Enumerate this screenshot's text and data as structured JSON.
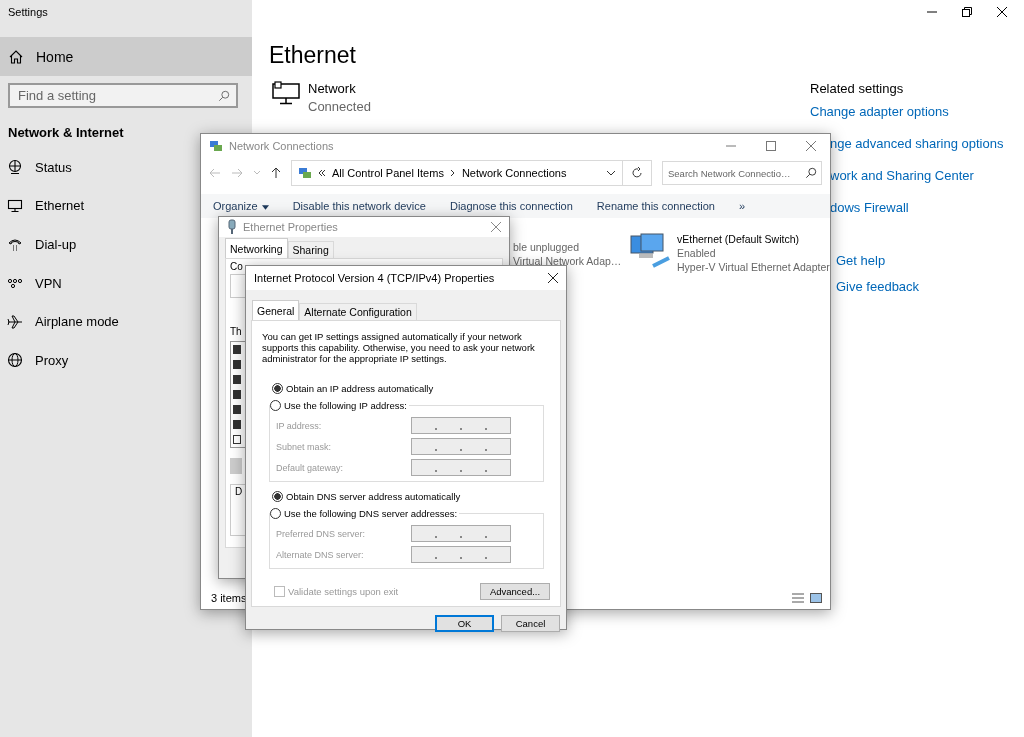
{
  "settings": {
    "title": "Settings",
    "home": "Home",
    "search_placeholder": "Find a setting",
    "section": "Network & Internet",
    "nav": [
      {
        "label": "Status"
      },
      {
        "label": "Ethernet"
      },
      {
        "label": "Dial-up"
      },
      {
        "label": "VPN"
      },
      {
        "label": "Airplane mode"
      },
      {
        "label": "Proxy"
      }
    ]
  },
  "page": {
    "heading": "Ethernet",
    "network_name": "Network",
    "network_status": "Connected"
  },
  "related": {
    "title": "Related settings",
    "links": [
      {
        "label": "Change adapter options",
        "cut": false
      },
      {
        "label": "nge advanced sharing options",
        "cut": true
      },
      {
        "label": "work and Sharing Center",
        "cut": true
      },
      {
        "label": "dows Firewall",
        "cut": true
      }
    ]
  },
  "help_links": [
    {
      "label": "Get help"
    },
    {
      "label": "Give feedback"
    }
  ],
  "network_connections": {
    "title": "Network Connections",
    "breadcrumb": [
      "All Control Panel Items",
      "Network Connections"
    ],
    "search_placeholder": "Search Network Connectio…",
    "toolbar": [
      {
        "label": "Organize",
        "dropdown": true
      },
      {
        "label": "Disable this network device",
        "dropdown": false
      },
      {
        "label": "Diagnose this connection",
        "dropdown": false
      },
      {
        "label": "Rename this connection",
        "dropdown": false
      }
    ],
    "more": "»",
    "adapters": [
      {
        "kind": "partial",
        "status": "ble unplugged",
        "device": "Virtual Network Adap…"
      },
      {
        "kind": "full",
        "name": "vEthernet (Default Switch)",
        "status": "Enabled",
        "device": "Hyper-V Virtual Ethernet Adapter"
      }
    ],
    "status_bar": "3 items"
  },
  "ethernet_properties": {
    "title": "Ethernet Properties",
    "tabs": [
      {
        "label": "Networking",
        "selected": true
      },
      {
        "label": "Sharing",
        "selected": false
      }
    ],
    "connect_label": "Co",
    "list_label": "Th",
    "description_label": "D",
    "components": [
      {
        "checked": true
      },
      {
        "checked": true
      },
      {
        "checked": true
      },
      {
        "checked": true
      },
      {
        "checked": true
      },
      {
        "checked": true
      },
      {
        "checked": false
      }
    ]
  },
  "ipv4": {
    "title": "Internet Protocol Version 4 (TCP/IPv4) Properties",
    "tabs": [
      {
        "label": "General",
        "selected": true
      },
      {
        "label": "Alternate Configuration",
        "selected": false
      }
    ],
    "intro": "You can get IP settings assigned automatically if your network supports this capability. Otherwise, you need to ask your network administrator for the appropriate IP settings.",
    "ip_auto": {
      "label": "Obtain an IP address automatically",
      "selected": true
    },
    "ip_manual": {
      "label": "Use the following IP address:",
      "selected": false
    },
    "ip_fields": [
      {
        "label": "IP address:"
      },
      {
        "label": "Subnet mask:"
      },
      {
        "label": "Default gateway:"
      }
    ],
    "dns_auto": {
      "label": "Obtain DNS server address automatically",
      "selected": true
    },
    "dns_manual": {
      "label": "Use the following DNS server addresses:",
      "selected": false
    },
    "dns_fields": [
      {
        "label": "Preferred DNS server:"
      },
      {
        "label": "Alternate DNS server:"
      }
    ],
    "validate": {
      "label": "Validate settings upon exit",
      "checked": false
    },
    "advanced": "Advanced...",
    "ok": "OK",
    "cancel": "Cancel"
  }
}
